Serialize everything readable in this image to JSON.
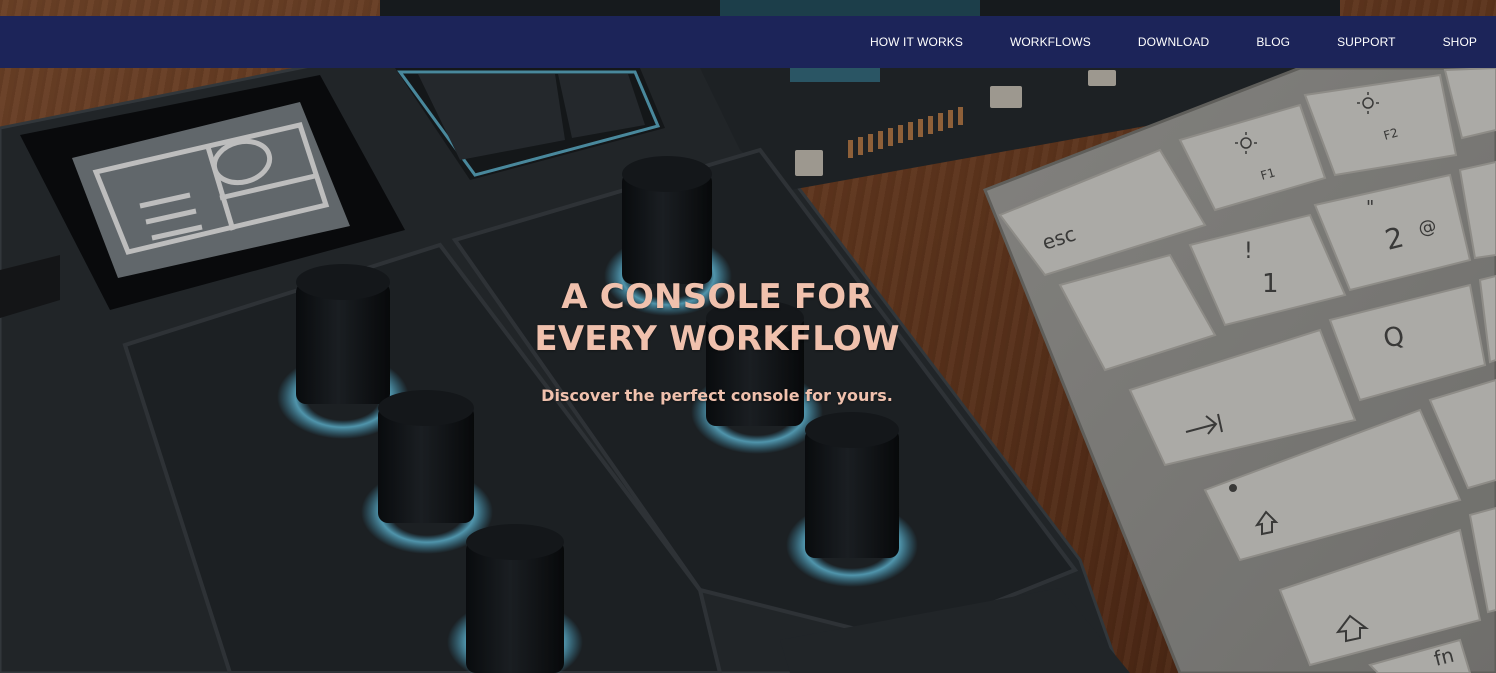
{
  "nav": {
    "items": [
      {
        "label": "HOW IT WORKS"
      },
      {
        "label": "WORKFLOWS"
      },
      {
        "label": "DOWNLOAD"
      },
      {
        "label": "BLOG"
      },
      {
        "label": "SUPPORT"
      },
      {
        "label": "SHOP"
      }
    ]
  },
  "hero": {
    "title_line1": "A CONSOLE FOR",
    "title_line2": "EVERY WORKFLOW",
    "subtitle": "Discover the perfect console for yours.",
    "keyboard_keys": {
      "esc": "esc",
      "f1": "F1",
      "f2": "F2",
      "quote": "\"",
      "two": "2",
      "at": "@",
      "excl": "!",
      "one": "1",
      "q": "Q",
      "fn": "fn"
    }
  },
  "colors": {
    "nav_bg": "#1c2459",
    "nav_text": "#ffffff",
    "headline": "#f0c1ad",
    "knob_glow": "#4fb8e0"
  }
}
